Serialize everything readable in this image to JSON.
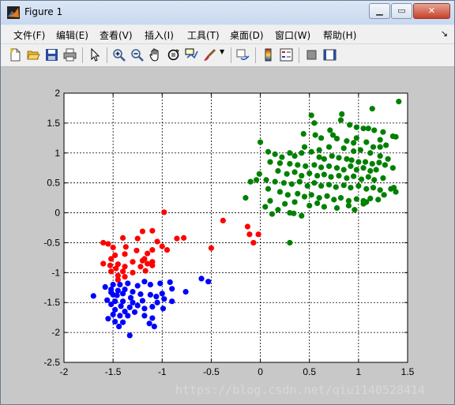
{
  "window": {
    "title": "Figure 1",
    "controls": [
      "minimize",
      "maximize",
      "close"
    ]
  },
  "menubar": {
    "items": [
      "文件(F)",
      "编辑(E)",
      "查看(V)",
      "插入(I)",
      "工具(T)",
      "桌面(D)",
      "窗口(W)",
      "帮助(H)"
    ]
  },
  "toolbar": {
    "buttons": [
      "new-figure-icon",
      "open-file-icon",
      "save-icon",
      "print-icon",
      "edit-plot-icon",
      "zoom-in-icon",
      "zoom-out-icon",
      "pan-icon",
      "rotate-3d-icon",
      "data-cursor-icon",
      "brush-icon",
      "link-plot-icon",
      "colorbar-icon",
      "legend-icon",
      "hide-plot-tools-icon",
      "show-plot-tools-icon"
    ]
  },
  "watermark": "https://blog.csdn.net/qiu1140528414",
  "chart_data": {
    "type": "scatter",
    "title": "",
    "xlabel": "",
    "ylabel": "",
    "xlim": [
      -2,
      1.5
    ],
    "ylim": [
      -2.5,
      2
    ],
    "xticks": [
      -2,
      -1.5,
      -1,
      -0.5,
      0,
      0.5,
      1,
      1.5
    ],
    "xtick_labels": [
      "-2",
      "-1.5",
      "-1",
      "-0.5",
      "0",
      "0.5",
      "1",
      "1.5"
    ],
    "yticks": [
      2,
      1.5,
      1,
      0.5,
      0,
      -0.5,
      -1,
      -1.5,
      -2,
      -2.5
    ],
    "ytick_labels": [
      "2",
      "1.5",
      "1",
      "0.5",
      "0",
      "-0.5",
      "-1",
      "-1.5",
      "-2",
      "-2.5"
    ],
    "grid": true,
    "colors": {
      "red": "#ff0000",
      "blue": "#0000ff",
      "green": "#008000"
    },
    "series": [
      {
        "color": "#ff0000",
        "points": [
          [
            -0.98,
            0.01
          ],
          [
            -1.1,
            -0.3
          ],
          [
            -1.2,
            -0.31
          ],
          [
            -1.25,
            -0.43
          ],
          [
            -1.4,
            -0.42
          ],
          [
            -1.55,
            -0.52
          ],
          [
            -1.6,
            -0.5
          ],
          [
            -1.5,
            -0.58
          ],
          [
            -1.37,
            -0.57
          ],
          [
            -0.78,
            -0.42
          ],
          [
            -0.85,
            -0.43
          ],
          [
            -1.05,
            -0.48
          ],
          [
            -0.95,
            -0.62
          ],
          [
            -1.0,
            -0.56
          ],
          [
            -0.5,
            -0.59
          ],
          [
            -1.1,
            -0.62
          ],
          [
            -1.15,
            -0.68
          ],
          [
            -1.26,
            -0.63
          ],
          [
            -1.38,
            -0.69
          ],
          [
            -1.48,
            -0.71
          ],
          [
            -1.52,
            -0.77
          ],
          [
            -1.6,
            -0.85
          ],
          [
            -1.53,
            -0.88
          ],
          [
            -1.45,
            -0.86
          ],
          [
            -1.38,
            -0.9
          ],
          [
            -1.3,
            -0.82
          ],
          [
            -1.2,
            -0.8
          ],
          [
            -1.18,
            -0.77
          ],
          [
            -1.15,
            -0.85
          ],
          [
            -1.1,
            -0.88
          ],
          [
            -1.47,
            -0.93
          ],
          [
            -1.4,
            -0.98
          ],
          [
            -1.52,
            -0.98
          ],
          [
            -1.45,
            -1.05
          ],
          [
            -1.38,
            -1.07
          ],
          [
            -1.3,
            -1.0
          ],
          [
            -1.45,
            -1.12
          ],
          [
            -1.22,
            -0.9
          ],
          [
            -1.1,
            -0.82
          ],
          [
            -0.38,
            -0.13
          ],
          [
            -0.13,
            -0.23
          ],
          [
            -0.11,
            -0.36
          ],
          [
            -0.02,
            -0.36
          ],
          [
            -0.07,
            -0.5
          ],
          [
            -1.17,
            -0.97
          ]
        ]
      },
      {
        "color": "#0000ff",
        "points": [
          [
            -0.6,
            -1.1
          ],
          [
            -0.53,
            -1.15
          ],
          [
            -0.92,
            -1.16
          ],
          [
            -1.02,
            -1.18
          ],
          [
            -1.12,
            -1.2
          ],
          [
            -1.18,
            -1.15
          ],
          [
            -1.25,
            -1.22
          ],
          [
            -1.35,
            -1.18
          ],
          [
            -1.43,
            -1.2
          ],
          [
            -1.5,
            -1.2
          ],
          [
            -1.58,
            -1.24
          ],
          [
            -1.52,
            -1.28
          ],
          [
            -1.45,
            -1.3
          ],
          [
            -1.38,
            -1.28
          ],
          [
            -1.3,
            -1.32
          ],
          [
            -0.9,
            -1.27
          ],
          [
            -0.76,
            -1.32
          ],
          [
            -1.0,
            -1.35
          ],
          [
            -1.52,
            -1.33
          ],
          [
            -1.5,
            -1.37
          ],
          [
            -1.46,
            -1.38
          ],
          [
            -1.4,
            -1.35
          ],
          [
            -1.32,
            -1.42
          ],
          [
            -1.22,
            -1.36
          ],
          [
            -1.12,
            -1.37
          ],
          [
            -1.06,
            -1.4
          ],
          [
            -0.98,
            -1.44
          ],
          [
            -0.9,
            -1.48
          ],
          [
            -1.05,
            -1.5
          ],
          [
            -1.2,
            -1.47
          ],
          [
            -1.3,
            -1.5
          ],
          [
            -1.4,
            -1.48
          ],
          [
            -1.48,
            -1.48
          ],
          [
            -1.56,
            -1.46
          ],
          [
            -1.52,
            -1.53
          ],
          [
            -1.42,
            -1.56
          ],
          [
            -1.33,
            -1.58
          ],
          [
            -1.25,
            -1.55
          ],
          [
            -1.18,
            -1.6
          ],
          [
            -1.1,
            -1.57
          ],
          [
            -0.99,
            -1.6
          ],
          [
            -1.48,
            -1.62
          ],
          [
            -1.38,
            -1.65
          ],
          [
            -1.28,
            -1.66
          ],
          [
            -1.5,
            -1.7
          ],
          [
            -1.43,
            -1.72
          ],
          [
            -1.35,
            -1.72
          ],
          [
            -1.18,
            -1.72
          ],
          [
            -1.1,
            -1.76
          ],
          [
            -1.55,
            -1.77
          ],
          [
            -1.48,
            -1.82
          ],
          [
            -1.4,
            -1.83
          ],
          [
            -1.13,
            -1.85
          ],
          [
            -1.33,
            -2.05
          ],
          [
            -1.08,
            -1.9
          ],
          [
            -1.44,
            -1.9
          ],
          [
            -1.7,
            -1.39
          ]
        ]
      },
      {
        "color": "#008000",
        "points": [
          [
            1.41,
            1.86
          ],
          [
            1.14,
            1.74
          ],
          [
            0.52,
            1.63
          ],
          [
            0.83,
            1.65
          ],
          [
            0.55,
            1.5
          ],
          [
            0.82,
            1.55
          ],
          [
            0.91,
            1.47
          ],
          [
            0.98,
            1.43
          ],
          [
            1.05,
            1.41
          ],
          [
            1.1,
            1.41
          ],
          [
            1.16,
            1.38
          ],
          [
            1.25,
            1.35
          ],
          [
            1.35,
            1.28
          ],
          [
            1.38,
            1.27
          ],
          [
            0.71,
            1.38
          ],
          [
            0.44,
            1.32
          ],
          [
            0.56,
            1.3
          ],
          [
            0.62,
            1.25
          ],
          [
            0.78,
            1.24
          ],
          [
            0.88,
            1.2
          ],
          [
            0.98,
            1.25
          ],
          [
            1.08,
            1.18
          ],
          [
            1.15,
            1.1
          ],
          [
            1.28,
            1.13
          ],
          [
            1.22,
            1.1
          ],
          [
            0.0,
            1.18
          ],
          [
            0.45,
            1.1
          ],
          [
            0.6,
            1.05
          ],
          [
            0.7,
            1.1
          ],
          [
            0.85,
            1.08
          ],
          [
            0.95,
            1.03
          ],
          [
            1.02,
            1.05
          ],
          [
            1.12,
            1.0
          ],
          [
            1.22,
            0.95
          ],
          [
            0.52,
            1.02
          ],
          [
            0.42,
            1.0
          ],
          [
            0.35,
            0.95
          ],
          [
            0.08,
            1.02
          ],
          [
            0.3,
            1.0
          ],
          [
            0.22,
            0.93
          ],
          [
            0.15,
            0.98
          ],
          [
            0.6,
            0.93
          ],
          [
            0.65,
            0.9
          ],
          [
            0.73,
            0.95
          ],
          [
            0.8,
            0.92
          ],
          [
            0.88,
            0.9
          ],
          [
            0.93,
            0.88
          ],
          [
            1.0,
            0.85
          ],
          [
            1.07,
            0.85
          ],
          [
            1.14,
            0.82
          ],
          [
            1.21,
            0.84
          ],
          [
            1.27,
            0.8
          ],
          [
            1.3,
            0.9
          ],
          [
            0.1,
            0.85
          ],
          [
            0.2,
            0.83
          ],
          [
            0.3,
            0.82
          ],
          [
            0.38,
            0.8
          ],
          [
            0.46,
            0.78
          ],
          [
            0.55,
            0.8
          ],
          [
            0.62,
            0.76
          ],
          [
            0.7,
            0.78
          ],
          [
            0.78,
            0.75
          ],
          [
            0.85,
            0.72
          ],
          [
            0.92,
            0.78
          ],
          [
            0.98,
            0.72
          ],
          [
            1.05,
            0.75
          ],
          [
            1.12,
            0.7
          ],
          [
            1.18,
            0.72
          ],
          [
            0.18,
            0.7
          ],
          [
            0.27,
            0.65
          ],
          [
            0.35,
            0.68
          ],
          [
            0.42,
            0.62
          ],
          [
            0.5,
            0.66
          ],
          [
            0.58,
            0.62
          ],
          [
            0.65,
            0.64
          ],
          [
            0.72,
            0.6
          ],
          [
            0.8,
            0.62
          ],
          [
            0.88,
            0.58
          ],
          [
            0.95,
            0.61
          ],
          [
            1.03,
            0.56
          ],
          [
            1.1,
            0.6
          ],
          [
            1.16,
            0.55
          ],
          [
            1.25,
            0.58
          ],
          [
            0.06,
            0.55
          ],
          [
            0.15,
            0.52
          ],
          [
            0.24,
            0.5
          ],
          [
            0.32,
            0.48
          ],
          [
            0.4,
            0.52
          ],
          [
            0.48,
            0.45
          ],
          [
            0.55,
            0.5
          ],
          [
            0.62,
            0.45
          ],
          [
            0.7,
            0.47
          ],
          [
            0.77,
            0.43
          ],
          [
            0.85,
            0.46
          ],
          [
            0.92,
            0.42
          ],
          [
            1.0,
            0.45
          ],
          [
            1.08,
            0.4
          ],
          [
            1.15,
            0.42
          ],
          [
            1.22,
            0.38
          ],
          [
            1.33,
            0.4
          ],
          [
            1.36,
            0.42
          ],
          [
            -0.04,
            0.55
          ],
          [
            0.08,
            0.4
          ],
          [
            0.2,
            0.35
          ],
          [
            0.28,
            0.3
          ],
          [
            0.38,
            0.32
          ],
          [
            0.45,
            0.27
          ],
          [
            0.52,
            0.3
          ],
          [
            0.6,
            0.25
          ],
          [
            0.68,
            0.28
          ],
          [
            0.75,
            0.22
          ],
          [
            0.82,
            0.25
          ],
          [
            0.9,
            0.2
          ],
          [
            0.98,
            0.23
          ],
          [
            1.05,
            0.2
          ],
          [
            1.12,
            0.24
          ],
          [
            1.2,
            0.22
          ],
          [
            1.26,
            0.3
          ],
          [
            1.38,
            0.35
          ],
          [
            0.1,
            0.2
          ],
          [
            0.25,
            0.15
          ],
          [
            0.35,
            0.18
          ],
          [
            0.5,
            0.12
          ],
          [
            0.58,
            0.16
          ],
          [
            0.65,
            0.1
          ],
          [
            0.78,
            0.08
          ],
          [
            0.9,
            0.12
          ],
          [
            0.96,
            0.05
          ],
          [
            1.05,
            0.15
          ],
          [
            1.08,
            0.18
          ],
          [
            -0.15,
            0.25
          ],
          [
            0.05,
            0.1
          ],
          [
            0.18,
            0.05
          ],
          [
            0.3,
            0.0
          ],
          [
            0.42,
            -0.05
          ],
          [
            -0.01,
            0.65
          ],
          [
            0.12,
            -0.02
          ],
          [
            -0.1,
            0.52
          ],
          [
            0.3,
            -0.5
          ],
          [
            1.35,
            0.75
          ],
          [
            1.22,
            1.22
          ],
          [
            0.34,
            -0.01
          ],
          [
            0.95,
            1.17
          ],
          [
            0.74,
            1.3
          ]
        ]
      }
    ]
  }
}
